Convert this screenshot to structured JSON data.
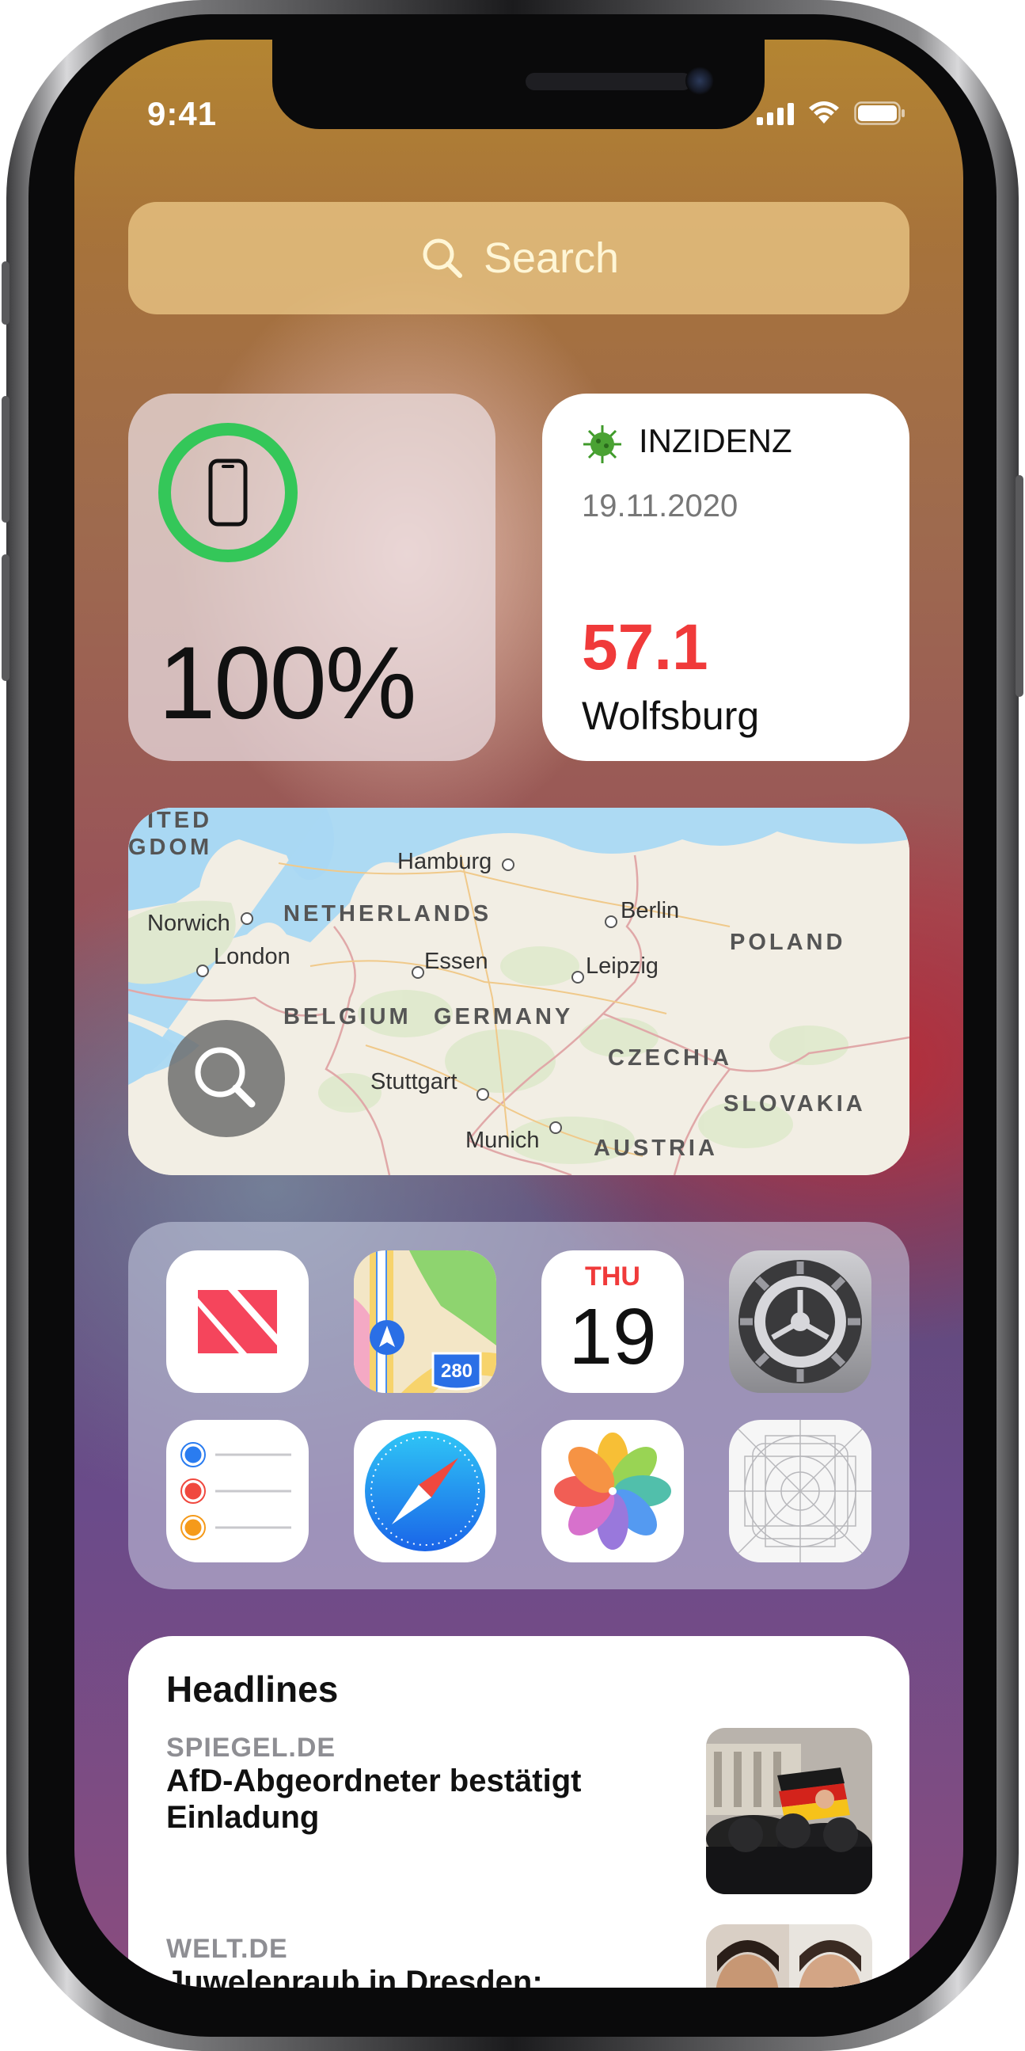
{
  "status_bar": {
    "time": "9:41"
  },
  "search": {
    "label": "Search"
  },
  "battery_widget": {
    "percent_text": "100%",
    "level": 1.0,
    "ring_color": "#34c759"
  },
  "incidence_widget": {
    "title": "INZIDENZ",
    "date": "19.11.2020",
    "value": "57.1",
    "city": "Wolfsburg",
    "value_color": "#f03a3a",
    "icon": "virus-icon"
  },
  "map_widget": {
    "regions": [
      "ITED",
      "GDOM",
      "NETHERLANDS",
      "BELGIUM",
      "GERMANY",
      "POLAND",
      "CZECHIA",
      "SLOVAKIA",
      "AUSTRIA"
    ],
    "cities": [
      "Hamburg",
      "Berlin",
      "Norwich",
      "London",
      "Essen",
      "Leipzig",
      "Stuttgart",
      "Munich"
    ]
  },
  "apps_widget": {
    "apps": [
      {
        "name": "News",
        "icon": "news-app-icon"
      },
      {
        "name": "Maps",
        "icon": "maps-app-icon",
        "badge": "280"
      },
      {
        "name": "Calendar",
        "icon": "calendar-app-icon",
        "weekday": "THU",
        "day": "19"
      },
      {
        "name": "Settings",
        "icon": "settings-app-icon"
      },
      {
        "name": "Reminders",
        "icon": "reminders-app-icon"
      },
      {
        "name": "Safari",
        "icon": "safari-app-icon"
      },
      {
        "name": "Photos",
        "icon": "photos-app-icon"
      },
      {
        "name": "Placeholder",
        "icon": "app-template-icon"
      }
    ]
  },
  "news_widget": {
    "title": "Headlines",
    "items": [
      {
        "source": "SPIEGEL.DE",
        "headline": "AfD-Abgeordneter bestätigt Einladung"
      },
      {
        "source": "WELT.DE",
        "headline": "Juwelenraub in Dresden:"
      }
    ]
  }
}
